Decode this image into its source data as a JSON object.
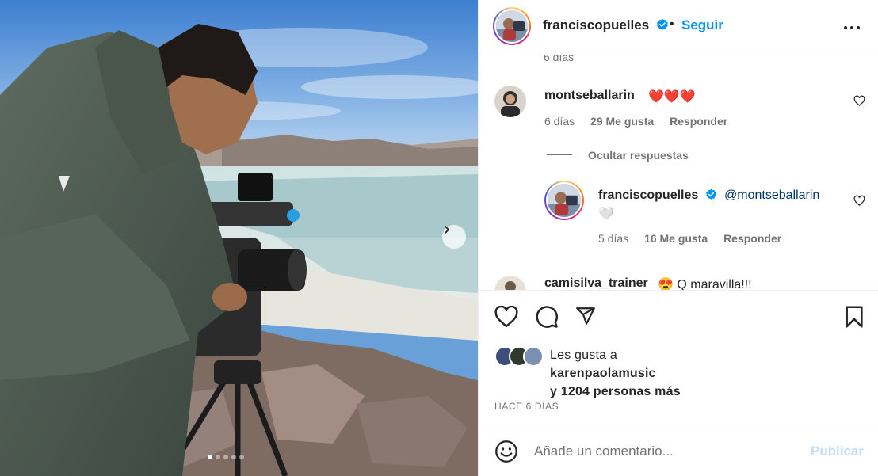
{
  "post": {
    "username": "franciscopuelles",
    "bullet": "•",
    "follow_label": "Seguir",
    "carousel_position": 1,
    "carousel_total": 5
  },
  "comments": {
    "cut_off_text": "6 días",
    "items": [
      {
        "username": "montseballarin",
        "text": "❤️❤️❤️",
        "time": "6 días",
        "likes": "29 Me gusta",
        "reply": "Responder"
      },
      {
        "username": "franciscopuelles",
        "mention": "@montseballarin",
        "text": "🤍",
        "time": "5 días",
        "likes": "16 Me gusta",
        "reply": "Responder"
      },
      {
        "username": "camisilva_trainer",
        "text": "😍 Q maravilla!!!"
      }
    ],
    "hide_replies": "Ocultar respuestas"
  },
  "likes": {
    "prefix": "Les gusta a",
    "user": "karenpaolamusic",
    "others": "y 1204 personas más"
  },
  "timestamp": "HACE 6 DÍAS",
  "composer": {
    "placeholder": "Añade un comentario...",
    "publish_label": "Publicar"
  },
  "colors": {
    "accent": "#0095f6",
    "publish_disabled": "#c0dffd",
    "secondary_text": "#737373"
  },
  "icons": [
    "verified-badge-icon",
    "more-options-icon",
    "heart-icon",
    "comment-icon",
    "share-icon",
    "bookmark-icon",
    "emoji-icon",
    "chevron-right-icon"
  ]
}
